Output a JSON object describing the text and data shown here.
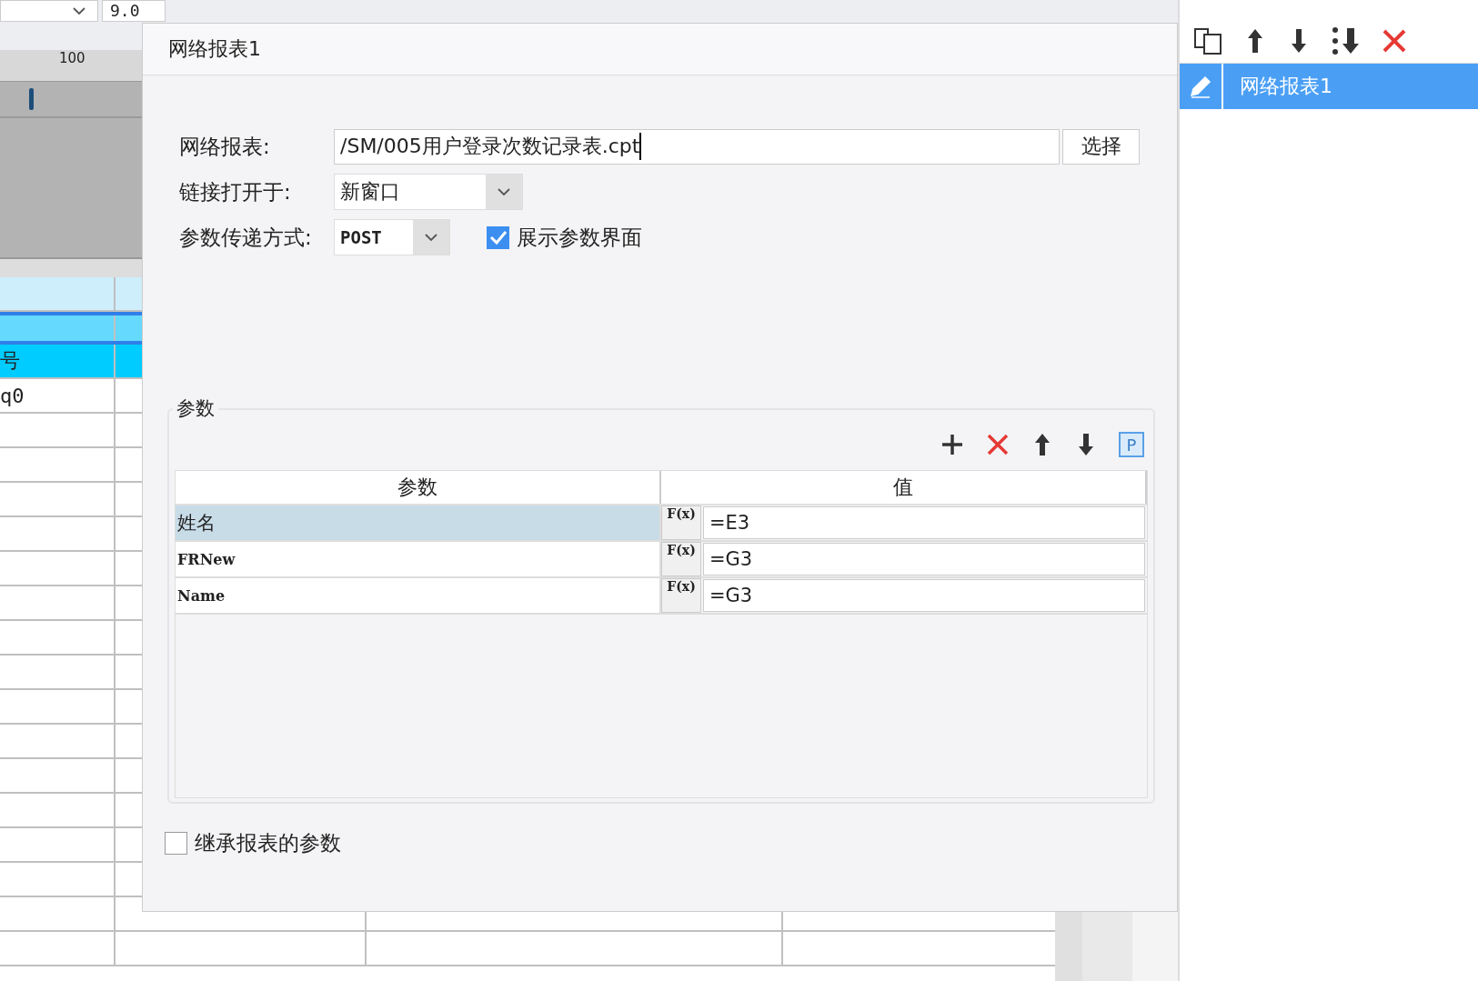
{
  "background_app": {
    "font_size_field": "9.0",
    "ruler_label": "100",
    "sheet_cells": [
      {
        "text": "号",
        "kind": "header"
      },
      {
        "text": "q0",
        "kind": "data"
      }
    ]
  },
  "hyperlink_list": {
    "items": [
      {
        "label": "网络报表1",
        "selected": true
      }
    ]
  },
  "dialog": {
    "title": "网络报表1",
    "report_label": "网络报表:",
    "report_path": "/SM/005用户登录次数记录表.cpt",
    "choose_button": "选择",
    "open_in_label": "链接打开于:",
    "open_in_value": "新窗口",
    "method_label": "参数传递方式:",
    "method_value": "POST",
    "show_params": {
      "label": "展示参数界面",
      "checked": true
    },
    "params": {
      "legend": "参数",
      "param_button": "P",
      "columns": [
        "参数",
        "值"
      ],
      "rows": [
        {
          "name": "姓名",
          "formula": "F(x)",
          "value": "=E3",
          "selected": true
        },
        {
          "name": "FRNew",
          "formula": "F(x)",
          "value": "=G3",
          "selected": false
        },
        {
          "name": "Name",
          "formula": "F(x)",
          "value": "=G3",
          "selected": false
        }
      ]
    },
    "inherit_params": {
      "label": "继承报表的参数",
      "checked": false
    }
  }
}
